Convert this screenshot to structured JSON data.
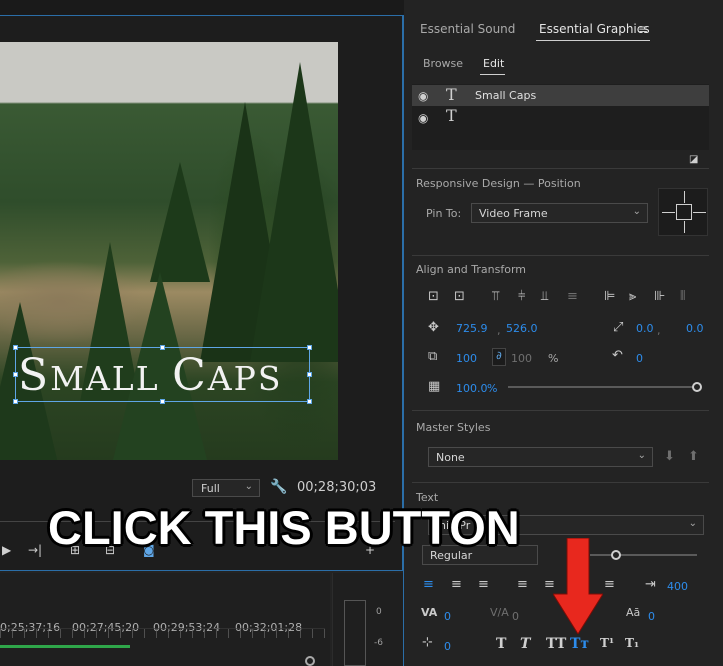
{
  "monitor": {
    "title_text_big1": "S",
    "title_text_small1": "MALL ",
    "title_text_big2": "C",
    "title_text_small2": "APS",
    "fit_value": "Full",
    "timecode": "00;28;30;03",
    "transport_icons": [
      "play-icon",
      "step-forward-icon",
      "lift-icon",
      "extract-icon",
      "camera-icon",
      "add-icon"
    ]
  },
  "timeline": {
    "timecodes": [
      "0;25;37;16",
      "00;27;45;20",
      "00;29;53;24",
      "00;32;01;28"
    ],
    "meter_labels": [
      "0",
      "-6"
    ]
  },
  "panel": {
    "tabs": [
      {
        "label": "Essential Sound"
      },
      {
        "label": "Essential Graphics"
      }
    ],
    "subtabs": [
      {
        "label": "Browse"
      },
      {
        "label": "Edit"
      }
    ],
    "layers": [
      {
        "name": "Small Caps"
      },
      {
        "name": ""
      }
    ],
    "responsive": {
      "title": "Responsive Design — Position",
      "pin_label": "Pin To:",
      "pin_value": "Video Frame"
    },
    "align": {
      "title": "Align and Transform",
      "position_x": "725.9",
      "position_comma": ",",
      "position_y": "526.0",
      "anchor_x": "0.0",
      "anchor_comma": ",",
      "anchor_y": "0.0",
      "scale": "100",
      "scale2": "100",
      "scale_unit": "%",
      "rotation": "0",
      "opacity": "100.0",
      "opacity_unit": "%"
    },
    "master": {
      "title": "Master Styles",
      "value": "None"
    },
    "text": {
      "title": "Text",
      "font_partial": "inio Pr",
      "style_value": "Regular",
      "tracking": "400",
      "kerning": "0",
      "tracking2": "0",
      "baseline": "0",
      "tsume": "0",
      "style_buttons": [
        "T",
        "T",
        "TT",
        "Tт",
        "T¹",
        "T₁"
      ]
    }
  },
  "overlay": {
    "instruction": "CLICK THIS BUTTON",
    "arrow_color": "#e8281e"
  }
}
